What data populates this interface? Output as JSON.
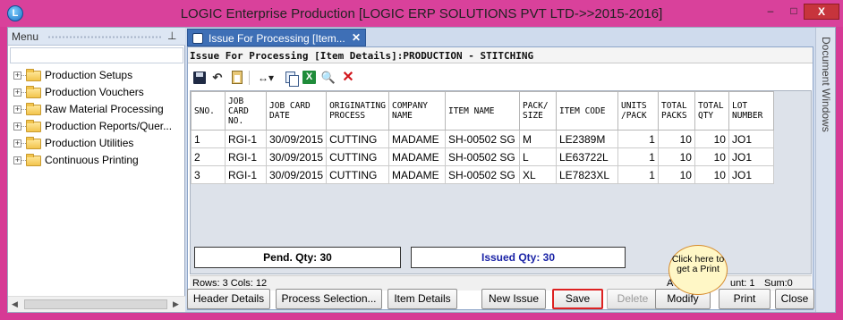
{
  "window": {
    "title": "LOGIC Enterprise Production  [LOGIC ERP SOLUTIONS PVT LTD->>2015-2016]",
    "minimize": "–",
    "maximize": "□",
    "close": "X",
    "app_icon": "L"
  },
  "menu": {
    "header": "Menu",
    "pin_icon": "⊥",
    "items": [
      {
        "label": "Production Setups"
      },
      {
        "label": "Production Vouchers"
      },
      {
        "label": "Raw Material Processing"
      },
      {
        "label": "Production  Reports/Quer..."
      },
      {
        "label": "Production Utilities"
      },
      {
        "label": "Continuous Printing"
      }
    ]
  },
  "tab": {
    "label": "Issue For Processing [Item...",
    "close": "✕"
  },
  "side_panel": {
    "label": "Document Windows"
  },
  "form": {
    "title": "Issue For Processing [Item Details]:PRODUCTION - STITCHING"
  },
  "toolbar": {
    "undo": "↶",
    "width": "↔▾",
    "excel": "X",
    "find": "🔍",
    "delete": "✕"
  },
  "grid": {
    "headers": [
      "SNO.",
      "JOB CARD NO.",
      "JOB CARD DATE",
      "ORIGINATING PROCESS",
      "COMPANY NAME",
      "ITEM NAME",
      "PACK/ SIZE",
      "ITEM CODE",
      "UNITS /PACK",
      "TOTAL PACKS",
      "TOTAL QTY",
      "LOT NUMBER"
    ],
    "rows": [
      [
        "1",
        "RGI-1",
        "30/09/2015",
        "CUTTING",
        "MADAME",
        "SH-00502 SG",
        "M",
        "LE2389M",
        "1",
        "10",
        "10",
        "JO1"
      ],
      [
        "2",
        "RGI-1",
        "30/09/2015",
        "CUTTING",
        "MADAME",
        "SH-00502 SG",
        "L",
        "LE63722L",
        "1",
        "10",
        "10",
        "JO1"
      ],
      [
        "3",
        "RGI-1",
        "30/09/2015",
        "CUTTING",
        "MADAME",
        "SH-00502 SG",
        "XL",
        "LE7823XL",
        "1",
        "10",
        "10",
        "JO1"
      ]
    ]
  },
  "status": {
    "rows_cols": "Rows: 3  Cols: 12",
    "avg": "Av",
    "count": "unt: 1",
    "sum": "Sum:0"
  },
  "qty": {
    "pending": "Pend. Qty: 30",
    "issued": "Issued Qty: 30"
  },
  "buttons": {
    "header_details": "Header Details",
    "process_selection": "Process Selection...",
    "item_details": "Item Details",
    "new_issue": "New Issue",
    "save": "Save",
    "delete": "Delete",
    "modify": "Modify",
    "print": "Print",
    "close": "Close"
  },
  "callout": {
    "text": "Click here to get a Print"
  }
}
